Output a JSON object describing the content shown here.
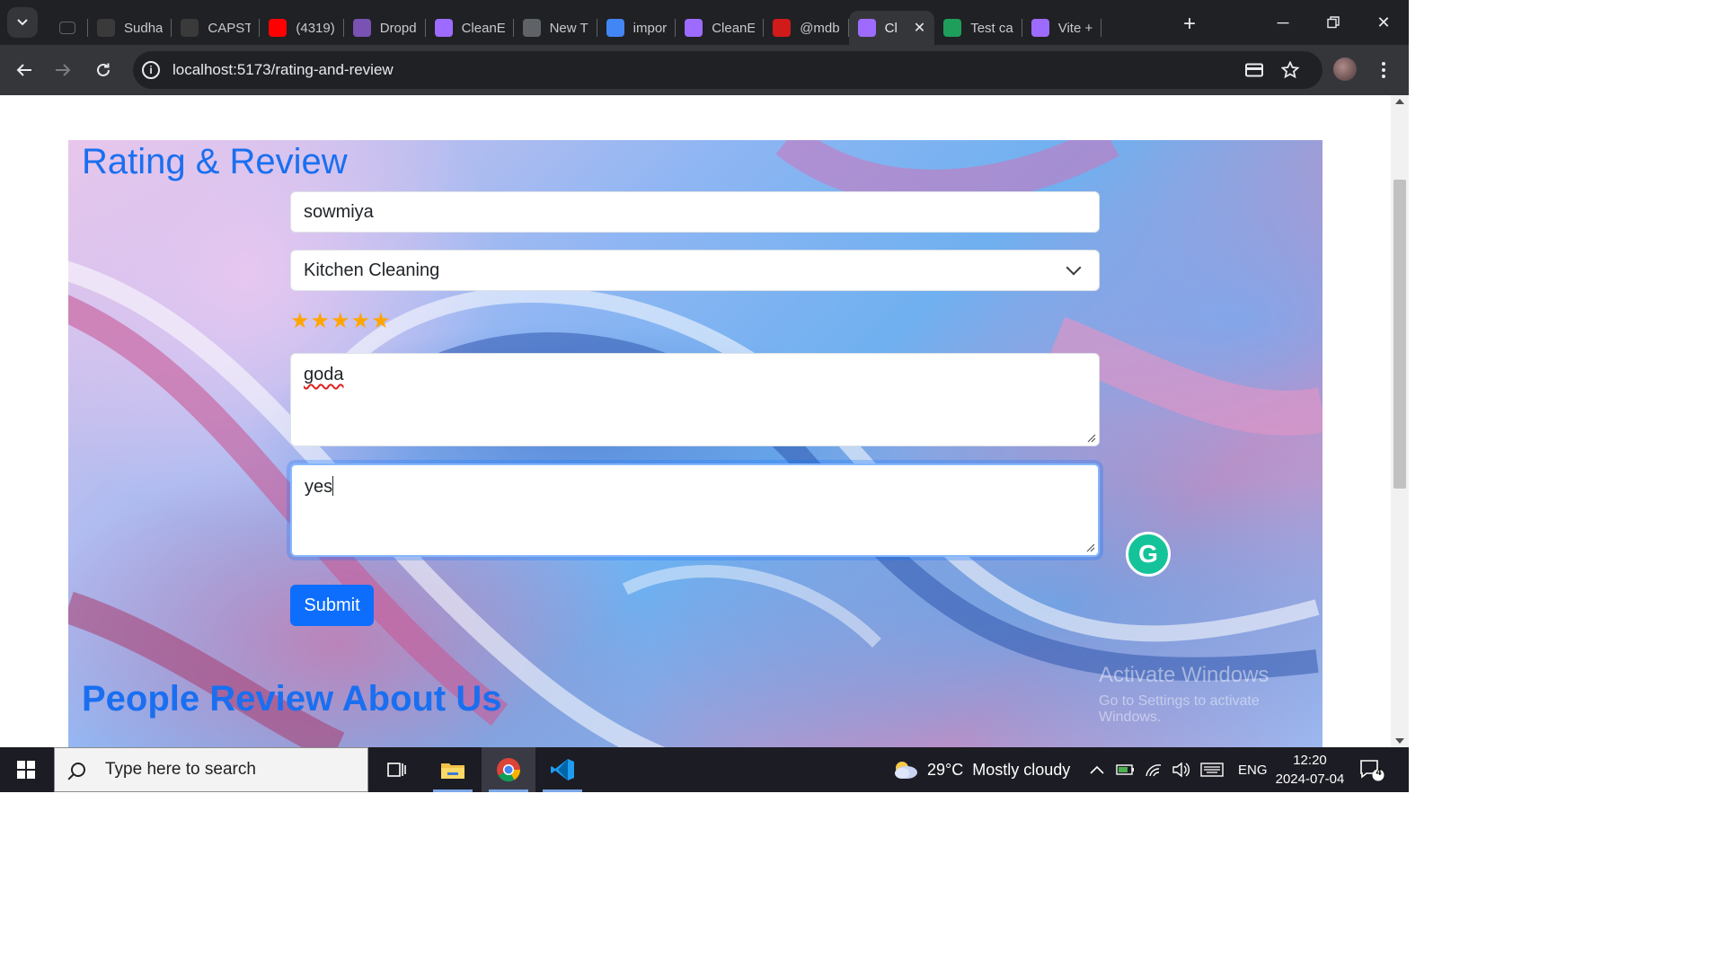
{
  "browser": {
    "tabs": [
      {
        "label": "Sudha",
        "icon": "github-icon",
        "color": "#3a3a3a"
      },
      {
        "label": "CAPST",
        "icon": "github-icon",
        "color": "#3a3a3a"
      },
      {
        "label": "(4319)",
        "icon": "youtube-icon",
        "color": "#ff0000"
      },
      {
        "label": "Dropd",
        "icon": "bootstrap-icon",
        "color": "#7952b3"
      },
      {
        "label": "CleanE",
        "icon": "vite-icon",
        "color": "#9d6bff"
      },
      {
        "label": "New T",
        "icon": "chrome-icon",
        "color": "#5f6368"
      },
      {
        "label": "impor",
        "icon": "google-icon",
        "color": "#4285f4"
      },
      {
        "label": "CleanE",
        "icon": "vite-icon",
        "color": "#9d6bff"
      },
      {
        "label": "@mdb",
        "icon": "netlify-icon",
        "color": "#d11a1a"
      },
      {
        "label": "Cl",
        "icon": "vite-icon",
        "color": "#9d6bff",
        "active": true
      },
      {
        "label": "Test ca",
        "icon": "sheets-icon",
        "color": "#1e9e5a"
      },
      {
        "label": "Vite +",
        "icon": "vite-icon",
        "color": "#9d6bff"
      }
    ],
    "url": "localhost:5173/rating-and-review"
  },
  "page": {
    "title": "Rating & Review",
    "name_value": "sowmiya",
    "service_value": "Kitchen Cleaning",
    "rating": 5,
    "rating_max": 5,
    "review_text": "goda",
    "extra_text": "yes",
    "submit_label": "Submit",
    "section_title": "People Review About Us",
    "accent_color": "#1a6ff0",
    "button_color": "#0d6efd"
  },
  "watermark": {
    "line1": "Activate Windows",
    "line2": "Go to Settings to activate Windows."
  },
  "taskbar": {
    "search_placeholder": "Type here to search",
    "weather_temp": "29°C",
    "weather_desc": "Mostly cloudy",
    "language": "ENG",
    "time": "12:20",
    "date": "2024-07-04",
    "notification_count": "4"
  }
}
